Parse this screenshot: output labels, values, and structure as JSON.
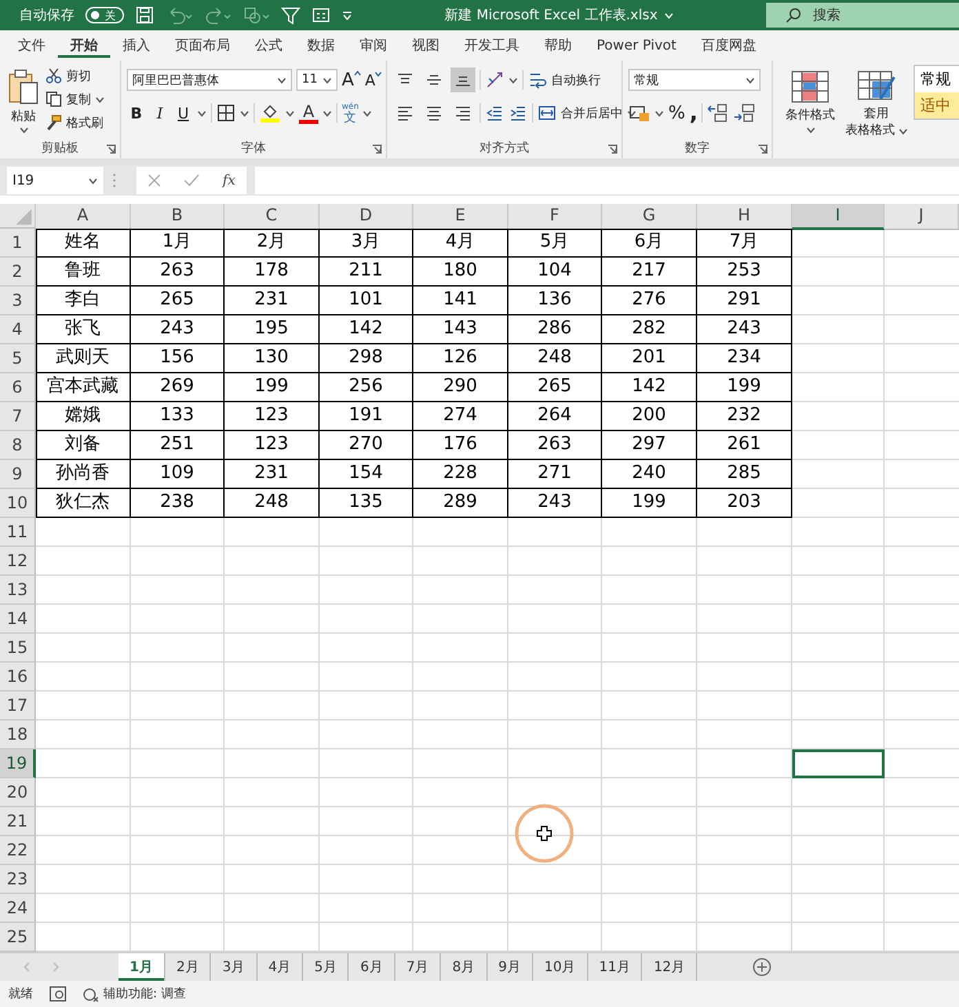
{
  "title_bar": {
    "autosave_label": "自动保存",
    "autosave_toggle": {
      "label": "关",
      "on": false
    },
    "title": "新建 Microsoft Excel 工作表.xlsx",
    "search": {
      "placeholder": "搜索"
    }
  },
  "menu_tabs": [
    {
      "label": "文件",
      "selected": false
    },
    {
      "label": "开始",
      "selected": true
    },
    {
      "label": "插入",
      "selected": false
    },
    {
      "label": "页面布局",
      "selected": false
    },
    {
      "label": "公式",
      "selected": false
    },
    {
      "label": "数据",
      "selected": false
    },
    {
      "label": "审阅",
      "selected": false
    },
    {
      "label": "视图",
      "selected": false
    },
    {
      "label": "开发工具",
      "selected": false
    },
    {
      "label": "帮助",
      "selected": false
    },
    {
      "label": "Power Pivot",
      "selected": false
    },
    {
      "label": "百度网盘",
      "selected": false
    }
  ],
  "ribbon": {
    "clipboard": {
      "paste": "粘贴",
      "cut": "剪切",
      "copy": "复制",
      "format_painter": "格式刷",
      "label": "剪贴板"
    },
    "font": {
      "name": "阿里巴巴普惠体",
      "size": "11",
      "grow": "A",
      "shrink": "A",
      "bold": "B",
      "italic": "I",
      "underline": "U",
      "font_color": "A",
      "phonetic_top": "wén",
      "phonetic": "文",
      "label": "字体"
    },
    "alignment": {
      "vertical_align": [
        {
          "selected": false
        },
        {
          "selected": false
        },
        {
          "selected": true
        }
      ],
      "wrap": "自动换行",
      "merge": "合并后居中",
      "label": "对齐方式"
    },
    "number": {
      "format": "常规",
      "percent": "%",
      "comma": ",",
      "label": "数字"
    },
    "styles": {
      "conditional": "条件格式",
      "table_format": [
        "套用",
        "表格格式"
      ],
      "cell_styles": [
        {
          "label": "常规",
          "kind": "normal"
        },
        {
          "label": "适中",
          "kind": "neutral"
        }
      ]
    }
  },
  "formula_bar": {
    "name_box": "I19",
    "fx": "fx"
  },
  "columns": [
    {
      "label": "A",
      "selected": false
    },
    {
      "label": "B",
      "selected": false
    },
    {
      "label": "C",
      "selected": false
    },
    {
      "label": "D",
      "selected": false
    },
    {
      "label": "E",
      "selected": false
    },
    {
      "label": "F",
      "selected": false
    },
    {
      "label": "G",
      "selected": false
    },
    {
      "label": "H",
      "selected": false
    },
    {
      "label": "I",
      "selected": true
    },
    {
      "label": "J",
      "selected": false
    }
  ],
  "rows": [
    {
      "label": "1",
      "selected": false
    },
    {
      "label": "2",
      "selected": false
    },
    {
      "label": "3",
      "selected": false
    },
    {
      "label": "4",
      "selected": false
    },
    {
      "label": "5",
      "selected": false
    },
    {
      "label": "6",
      "selected": false
    },
    {
      "label": "7",
      "selected": false
    },
    {
      "label": "8",
      "selected": false
    },
    {
      "label": "9",
      "selected": false
    },
    {
      "label": "10",
      "selected": false
    },
    {
      "label": "11",
      "selected": false
    },
    {
      "label": "12",
      "selected": false
    },
    {
      "label": "13",
      "selected": false
    },
    {
      "label": "14",
      "selected": false
    },
    {
      "label": "15",
      "selected": false
    },
    {
      "label": "16",
      "selected": false
    },
    {
      "label": "17",
      "selected": false
    },
    {
      "label": "18",
      "selected": false
    },
    {
      "label": "19",
      "selected": true
    },
    {
      "label": "20",
      "selected": false
    },
    {
      "label": "21",
      "selected": false
    },
    {
      "label": "22",
      "selected": false
    },
    {
      "label": "23",
      "selected": false
    },
    {
      "label": "24",
      "selected": false
    },
    {
      "label": "25",
      "selected": false
    }
  ],
  "table": [
    [
      "姓名",
      "1月",
      "2月",
      "3月",
      "4月",
      "5月",
      "6月",
      "7月"
    ],
    [
      "鲁班",
      "263",
      "178",
      "211",
      "180",
      "104",
      "217",
      "253"
    ],
    [
      "李白",
      "265",
      "231",
      "101",
      "141",
      "136",
      "276",
      "291"
    ],
    [
      "张飞",
      "243",
      "195",
      "142",
      "143",
      "286",
      "282",
      "243"
    ],
    [
      "武则天",
      "156",
      "130",
      "298",
      "126",
      "248",
      "201",
      "234"
    ],
    [
      "宫本武藏",
      "269",
      "199",
      "256",
      "290",
      "265",
      "142",
      "199"
    ],
    [
      "嫦娥",
      "133",
      "123",
      "191",
      "274",
      "264",
      "200",
      "232"
    ],
    [
      "刘备",
      "251",
      "123",
      "270",
      "176",
      "263",
      "297",
      "261"
    ],
    [
      "孙尚香",
      "109",
      "231",
      "154",
      "228",
      "271",
      "240",
      "285"
    ],
    [
      "狄仁杰",
      "238",
      "248",
      "135",
      "289",
      "243",
      "199",
      "203"
    ]
  ],
  "sheet_tabs": [
    {
      "label": "1月",
      "selected": true
    },
    {
      "label": "2月",
      "selected": false
    },
    {
      "label": "3月",
      "selected": false
    },
    {
      "label": "4月",
      "selected": false
    },
    {
      "label": "5月",
      "selected": false
    },
    {
      "label": "6月",
      "selected": false
    },
    {
      "label": "7月",
      "selected": false
    },
    {
      "label": "8月",
      "selected": false
    },
    {
      "label": "9月",
      "selected": false
    },
    {
      "label": "10月",
      "selected": false
    },
    {
      "label": "11月",
      "selected": false
    },
    {
      "label": "12月",
      "selected": false
    }
  ],
  "status_bar": {
    "ready": "就绪",
    "accessibility": "辅助功能: 调查"
  }
}
